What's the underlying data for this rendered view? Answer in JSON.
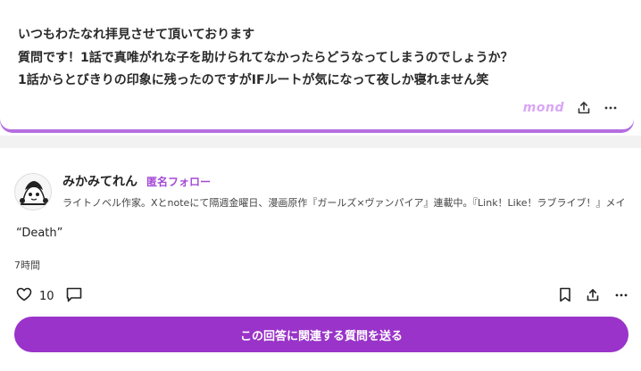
{
  "question": {
    "lines": [
      "いつもわたなれ拝見させて頂いております",
      "質問です！1話で真唯がれな子を助けられてなかったらどうなってしまうのでしょうか？",
      "1話からとびきりの印象に残ったのですがIFルートが気になって夜しか寝れません笑"
    ],
    "brand": "mond",
    "share_icon": "share-icon",
    "more_icon": "more-icon"
  },
  "answer": {
    "author_name": "みかみてれん",
    "follow_label": "匿名フォロー",
    "bio": "ライトノベル作家。Xとnoteにて隔週金曜日、漫画原作『ガールズ×ヴァンパイア』連載中。『Link！Like！ラブライブ！』メインシナリオ執...",
    "text": "“Death”",
    "timestamp": "7時間",
    "like_count": "10",
    "cta_label": "この回答に関連する質問を送る"
  },
  "colors": {
    "accent": "#9a33c9",
    "card_border": "#b56ee0",
    "brand": "#d9a6f5"
  }
}
